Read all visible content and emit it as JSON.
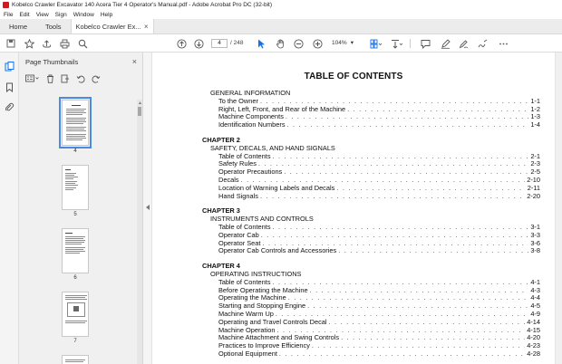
{
  "window": {
    "title": "Kobelco Crawler Excavator 140 Acera Tier 4 Operator's Manual.pdf - Adobe Acrobat Pro DC (32-bit)"
  },
  "menu": [
    "File",
    "Edit",
    "View",
    "Sign",
    "Window",
    "Help"
  ],
  "tabs": {
    "home": "Home",
    "tools": "Tools",
    "document": "Kobelco Crawler Ex...",
    "close": "×"
  },
  "toolbar": {
    "current_page": "4",
    "total_pages": "/ 248",
    "zoom": "104%"
  },
  "thumbnails": {
    "title": "Page Thumbnails",
    "close": "×",
    "pages": [
      "4",
      "5",
      "6",
      "7"
    ]
  },
  "toc": {
    "title": "TABLE OF CONTENTS",
    "sections": [
      {
        "chapter": "",
        "heading": "GENERAL INFORMATION",
        "entries": [
          {
            "text": "To the Owner",
            "page": "1-1"
          },
          {
            "text": "Right, Left, Front, and Rear of the Machine",
            "page": "1-2"
          },
          {
            "text": "Machine Components",
            "page": "1-3"
          },
          {
            "text": "Identification Numbers",
            "page": "1-4"
          }
        ]
      },
      {
        "chapter": "CHAPTER 2",
        "heading": "SAFETY, DECALS, AND HAND SIGNALS",
        "entries": [
          {
            "text": "Table of Contents",
            "page": "2-1"
          },
          {
            "text": "Safety Rules",
            "page": "2-3"
          },
          {
            "text": "Operator Precautions",
            "page": "2-5"
          },
          {
            "text": "Decals",
            "page": "2-10"
          },
          {
            "text": "Location of Warning Labels and Decals",
            "page": "2-11"
          },
          {
            "text": "Hand Signals",
            "page": "2-20"
          }
        ]
      },
      {
        "chapter": "CHAPTER 3",
        "heading": "INSTRUMENTS AND CONTROLS",
        "entries": [
          {
            "text": "Table of Contents",
            "page": "3-1"
          },
          {
            "text": "Operator Cab",
            "page": "3-3"
          },
          {
            "text": "Operator Seat",
            "page": "3-6"
          },
          {
            "text": "Operator Cab Controls and Accessories",
            "page": "3-8"
          }
        ]
      },
      {
        "chapter": "CHAPTER 4",
        "heading": "OPERATING INSTRUCTIONS",
        "entries": [
          {
            "text": "Table of Contents",
            "page": "4-1"
          },
          {
            "text": "Before Operating the Machine",
            "page": "4-3"
          },
          {
            "text": "Operating the Machine",
            "page": "4-4"
          },
          {
            "text": "Starting and Stopping Engine",
            "page": "4-5"
          },
          {
            "text": "Machine Warm Up",
            "page": "4-9"
          },
          {
            "text": "Operating and Travel Controls Decal",
            "page": "4-14"
          },
          {
            "text": "Machine Operation",
            "page": "4-15"
          },
          {
            "text": "Machine Attachment and Swing Controls",
            "page": "4-20"
          },
          {
            "text": "Practices to Improve Efficiency",
            "page": "4-23"
          },
          {
            "text": "Optional Equipment",
            "page": "4-28"
          }
        ]
      }
    ]
  },
  "colors": {
    "accent": "#1473e6",
    "app_red": "#d4181f"
  }
}
